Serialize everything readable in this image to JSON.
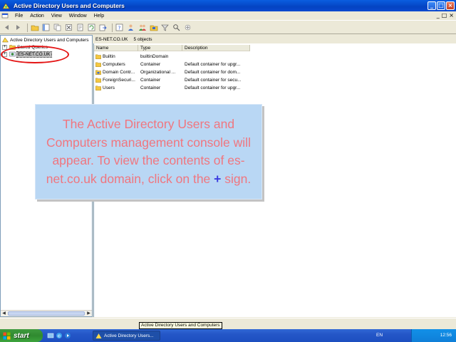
{
  "window": {
    "title": "Active Directory Users and Computers",
    "min_glyph": "_",
    "max_glyph": "□",
    "close_glyph": "×"
  },
  "menu": {
    "items": [
      "File",
      "Action",
      "View",
      "Window",
      "Help"
    ],
    "mdi_min": "_",
    "mdi_max": "□",
    "mdi_close": "×"
  },
  "toolbar": {
    "icons": [
      "back-icon",
      "forward-icon",
      "up-folder-icon",
      "show-tree-icon",
      "copy-icon",
      "delete-icon",
      "properties-icon",
      "refresh-icon",
      "export-icon",
      "help-icon",
      "new-user-icon",
      "new-group-icon",
      "new-ou-icon",
      "filter-icon",
      "find-icon",
      "add-to-group-icon"
    ]
  },
  "tree": {
    "root": "Active Directory Users and Computers",
    "items": [
      {
        "label": "Saved Queries",
        "expander": "+"
      },
      {
        "label": "ES-NET.CO.UK",
        "expander": "+"
      }
    ]
  },
  "right_header": {
    "domain": "ES-NET.CO.UK",
    "count": "5 objects"
  },
  "list": {
    "columns": [
      "Name",
      "Type",
      "Description"
    ],
    "rows": [
      {
        "name": "Builtin",
        "type": "builtinDomain",
        "desc": ""
      },
      {
        "name": "Computers",
        "type": "Container",
        "desc": "Default container for upgr..."
      },
      {
        "name": "Domain Contr...",
        "type": "Organizational ...",
        "desc": "Default container for dom..."
      },
      {
        "name": "ForeignSecuri...",
        "type": "Container",
        "desc": "Default container for secu..."
      },
      {
        "name": "Users",
        "type": "Container",
        "desc": "Default container for upgr..."
      }
    ]
  },
  "overlay": {
    "text_main": "The Active Directory Users and Computers management console will appear. To view the contents of es-net.co.uk domain, click on the",
    "plus": "+",
    "text_end": "sign."
  },
  "statusbar": {
    "tooltip": "Active Directory Users and Computers"
  },
  "taskbar": {
    "start_label": "start",
    "task_label": "Active Directory Users...",
    "lang": "EN",
    "clock": "12:56"
  },
  "colors": {
    "title_blue": "#0443c2",
    "overlay_bg": "#b9d7f4",
    "overlay_text": "#f0767f",
    "highlight_ellipse": "#e41414",
    "start_green": "#2f8a2f"
  }
}
